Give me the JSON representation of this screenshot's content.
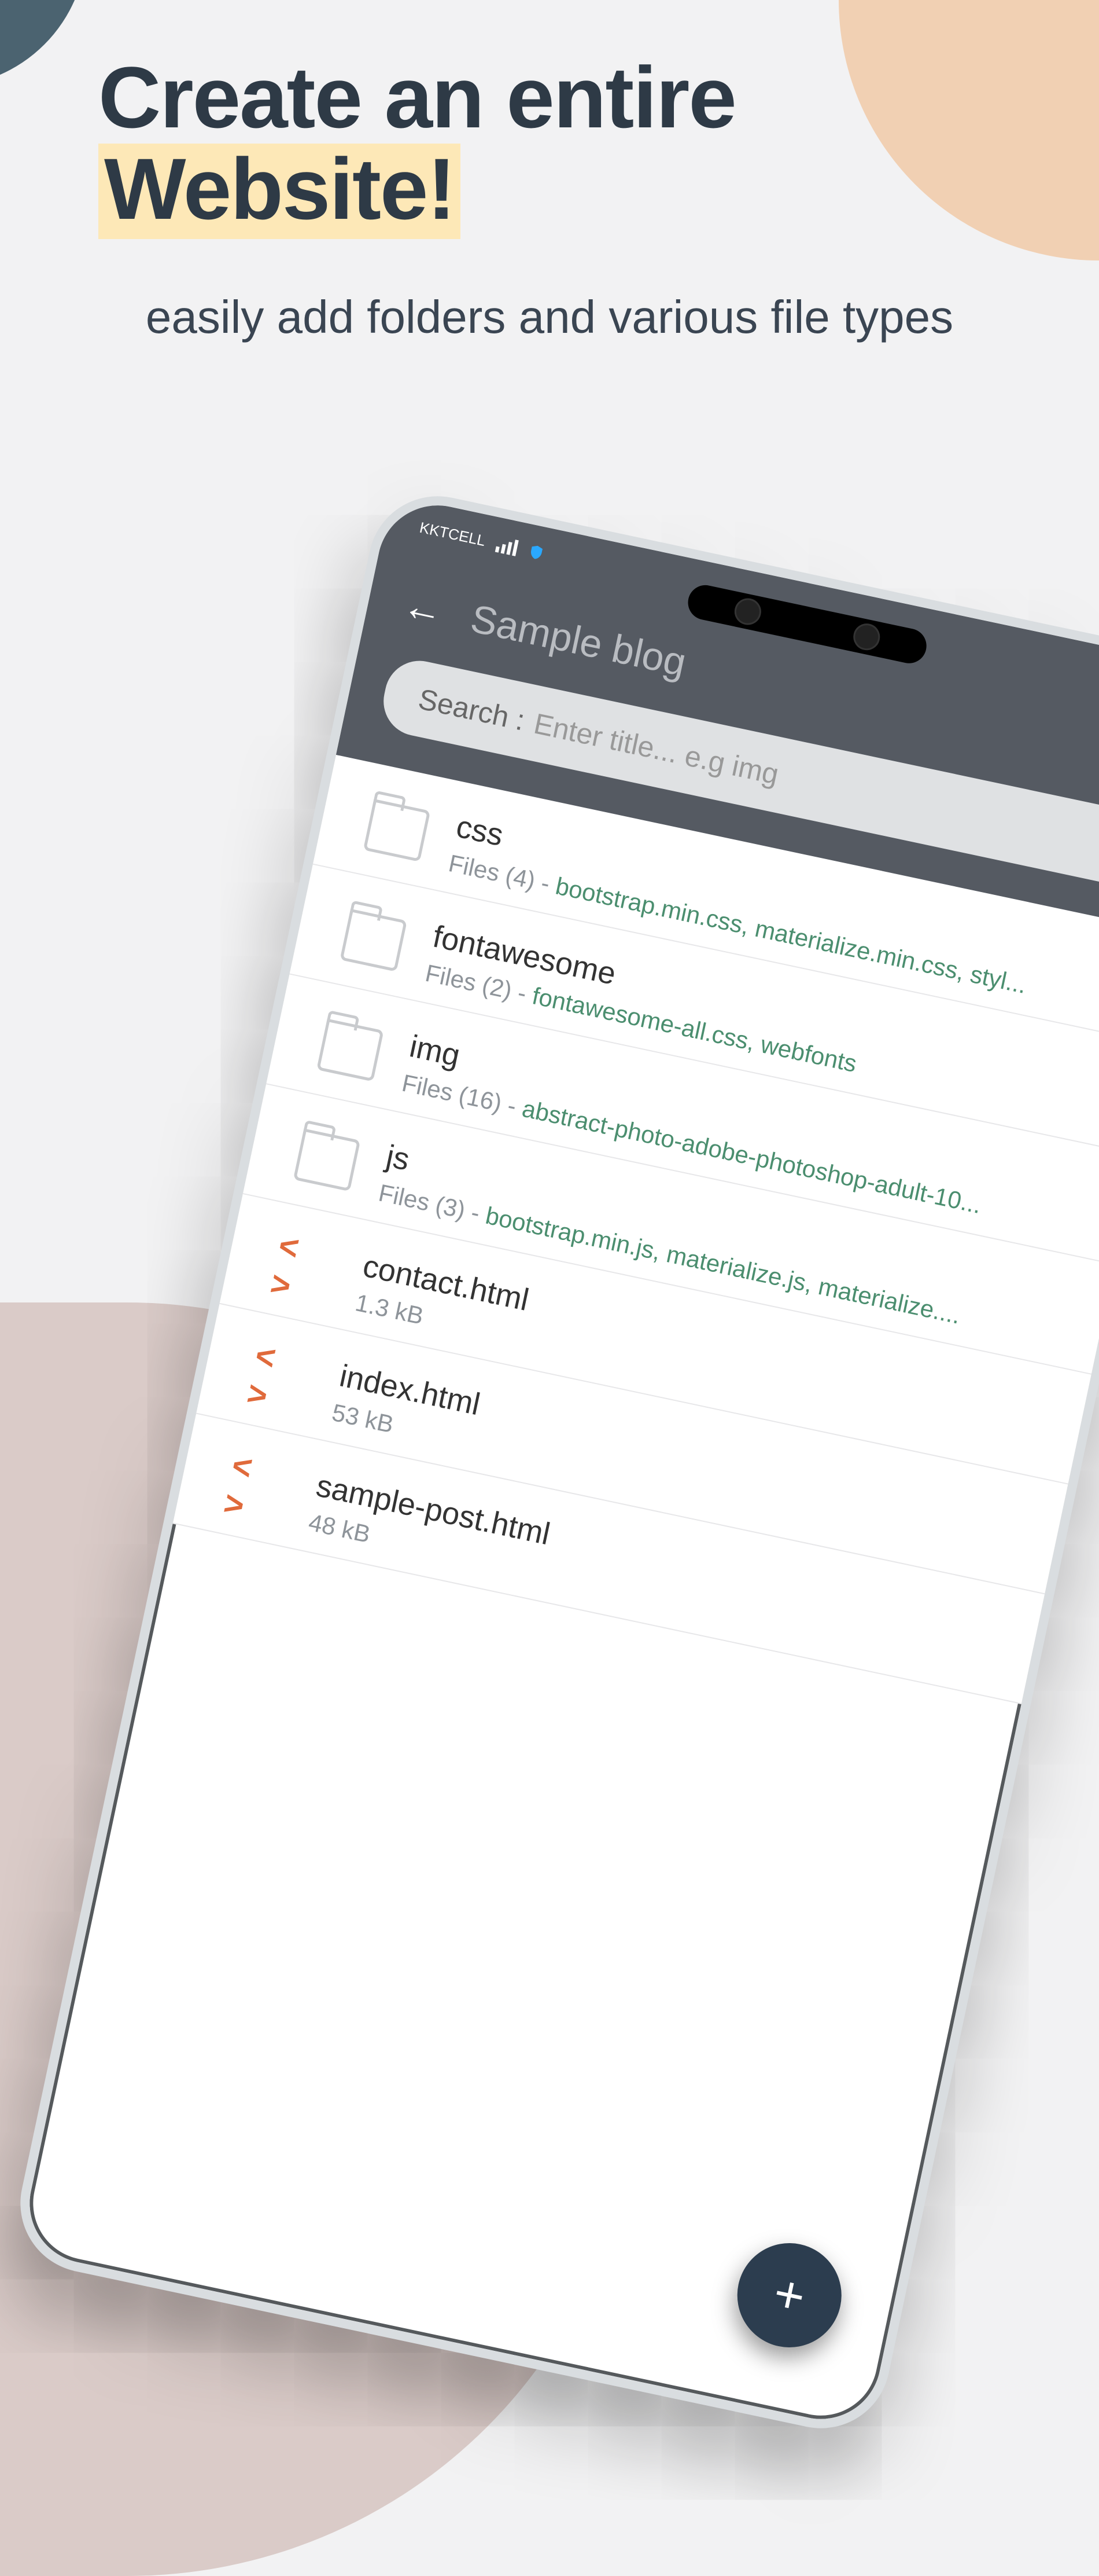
{
  "headline": {
    "line1": "Create an entire",
    "line2": "Website!"
  },
  "subhead": "easily add folders and various file types",
  "status": {
    "carrier": "KKTCELL"
  },
  "appbar": {
    "title": "Sample blog"
  },
  "search": {
    "label": "Search :",
    "placeholder": "Enter title... e.g img"
  },
  "rows": [
    {
      "type": "folder",
      "name": "css",
      "count": "Files (4)",
      "detail": "bootstrap.min.css, materialize.min.css, styl..."
    },
    {
      "type": "folder",
      "name": "fontawesome",
      "count": "Files (2)",
      "detail": "fontawesome-all.css, webfonts"
    },
    {
      "type": "folder",
      "name": "img",
      "count": "Files (16)",
      "detail": "abstract-photo-adobe-photoshop-adult-10..."
    },
    {
      "type": "folder",
      "name": "js",
      "count": "Files (3)",
      "detail": "bootstrap.min.js, materialize.js, materialize...."
    },
    {
      "type": "file",
      "name": "contact.html",
      "size": "1.3 kB"
    },
    {
      "type": "file",
      "name": "index.html",
      "size": "53 kB"
    },
    {
      "type": "file",
      "name": "sample-post.html",
      "size": "48 kB"
    }
  ],
  "fab": {
    "label": "+"
  }
}
